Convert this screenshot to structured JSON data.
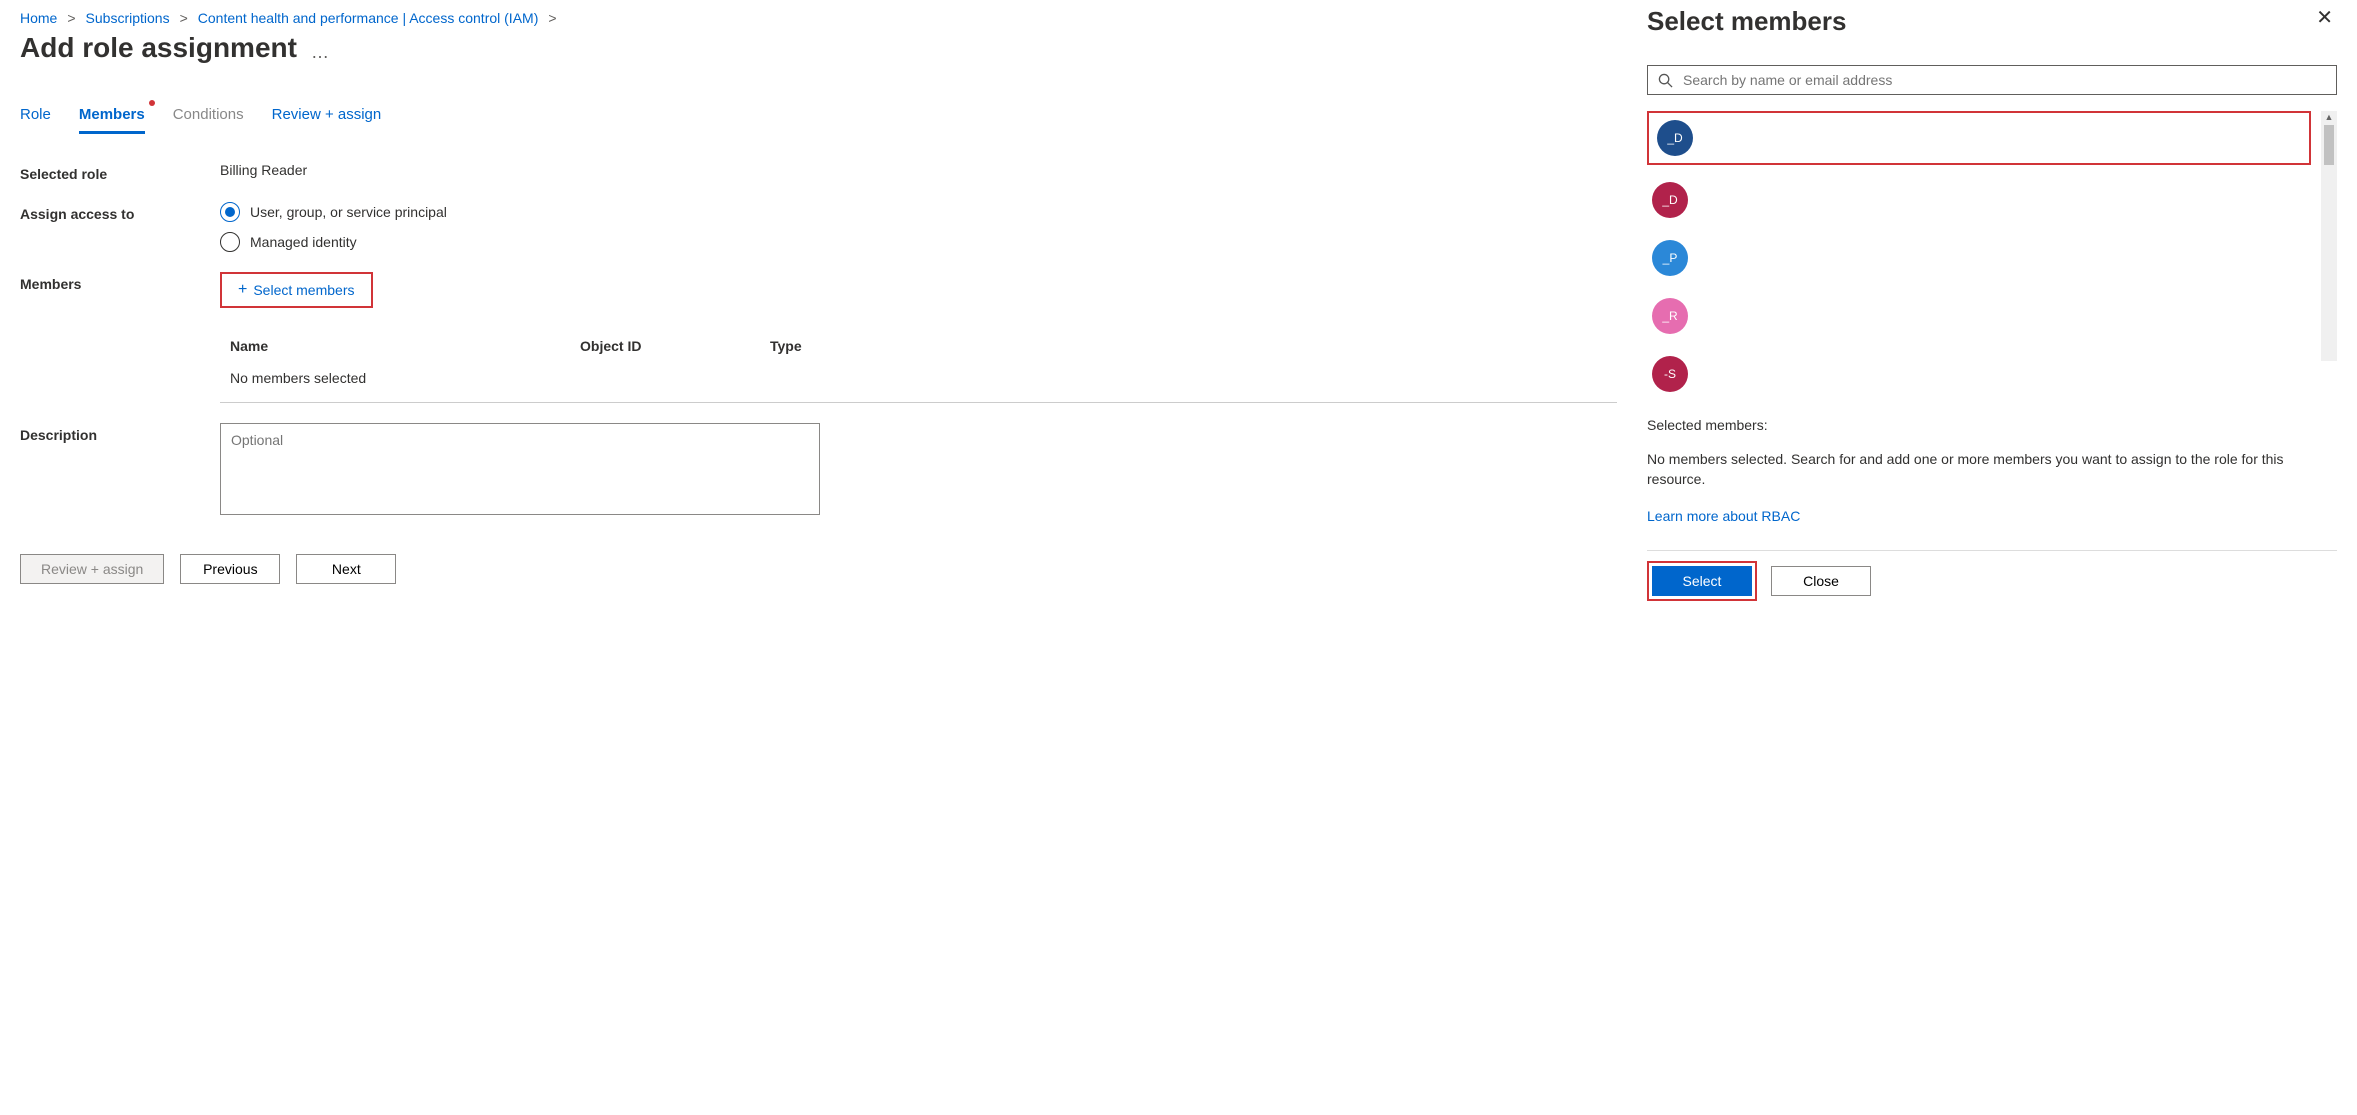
{
  "breadcrumb": {
    "items": [
      {
        "label": "Home"
      },
      {
        "label": "Subscriptions"
      },
      {
        "label": "Content health and performance | Access control (IAM)"
      }
    ]
  },
  "pageTitle": "Add role assignment",
  "tabs": [
    {
      "label": "Role",
      "active": false,
      "disabled": false
    },
    {
      "label": "Members",
      "active": true,
      "disabled": false,
      "dot": true
    },
    {
      "label": "Conditions",
      "active": false,
      "disabled": true
    },
    {
      "label": "Review + assign",
      "active": false,
      "disabled": false
    }
  ],
  "form": {
    "selectedRoleLabel": "Selected role",
    "selectedRoleValue": "Billing Reader",
    "assignAccessLabel": "Assign access to",
    "radios": [
      {
        "label": "User, group, or service principal",
        "checked": true
      },
      {
        "label": "Managed identity",
        "checked": false
      }
    ],
    "membersLabel": "Members",
    "selectMembersLink": "Select members",
    "tableHeaders": {
      "name": "Name",
      "objectId": "Object ID",
      "type": "Type"
    },
    "noMembersText": "No members selected",
    "descriptionLabel": "Description",
    "descriptionPlaceholder": "Optional"
  },
  "footer": {
    "reviewAssign": "Review + assign",
    "previous": "Previous",
    "next": "Next"
  },
  "sidePanel": {
    "title": "Select members",
    "searchPlaceholder": "Search by name or email address",
    "members": [
      {
        "initials": "_D",
        "color": "#1e4e8c",
        "highlight": true
      },
      {
        "initials": "_D",
        "color": "#b1224b",
        "highlight": false
      },
      {
        "initials": "_P",
        "color": "#2b88d8",
        "highlight": false
      },
      {
        "initials": "_R",
        "color": "#e66db0",
        "highlight": false
      },
      {
        "initials": "-S",
        "color": "#b1224b",
        "highlight": false
      }
    ],
    "selectedMembersLabel": "Selected members:",
    "selectedMembersDesc": "No members selected. Search for and add one or more members you want to assign to the role for this resource.",
    "learnMoreLabel": "Learn more about RBAC",
    "selectBtn": "Select",
    "closeBtn": "Close"
  }
}
